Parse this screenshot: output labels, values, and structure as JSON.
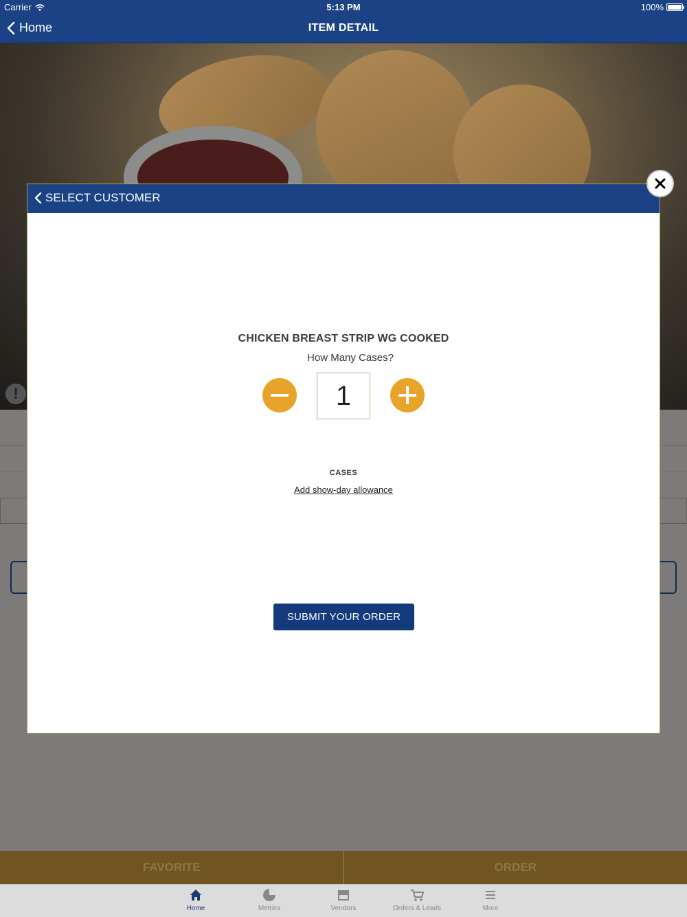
{
  "status_bar": {
    "carrier": "Carrier",
    "time": "5:13 PM",
    "battery": "100%"
  },
  "nav": {
    "back_label": "Home",
    "title": "ITEM DETAIL"
  },
  "modal": {
    "header_back_label": "SELECT CUSTOMER",
    "product_name": "CHICKEN BREAST STRIP WG COOKED",
    "question": "How Many Cases?",
    "quantity": "1",
    "unit_label": "CASES",
    "allowance_link": "Add show-day allowance",
    "submit_label": "SUBMIT YOUR ORDER"
  },
  "actions": {
    "favorite_label": "FAVORITE",
    "order_label": "ORDER"
  },
  "tabbar": {
    "items": [
      {
        "label": "Home",
        "icon": "home-icon",
        "active": true
      },
      {
        "label": "Metrics",
        "icon": "pie-chart-icon",
        "active": false
      },
      {
        "label": "Vendors",
        "icon": "storefront-icon",
        "active": false
      },
      {
        "label": "Orders & Leads",
        "icon": "cart-icon",
        "active": false
      },
      {
        "label": "More",
        "icon": "menu-icon",
        "active": false
      }
    ]
  },
  "colors": {
    "brand_blue": "#1a4284",
    "accent_orange": "#e7a32a",
    "submit_blue": "#123a7c"
  }
}
